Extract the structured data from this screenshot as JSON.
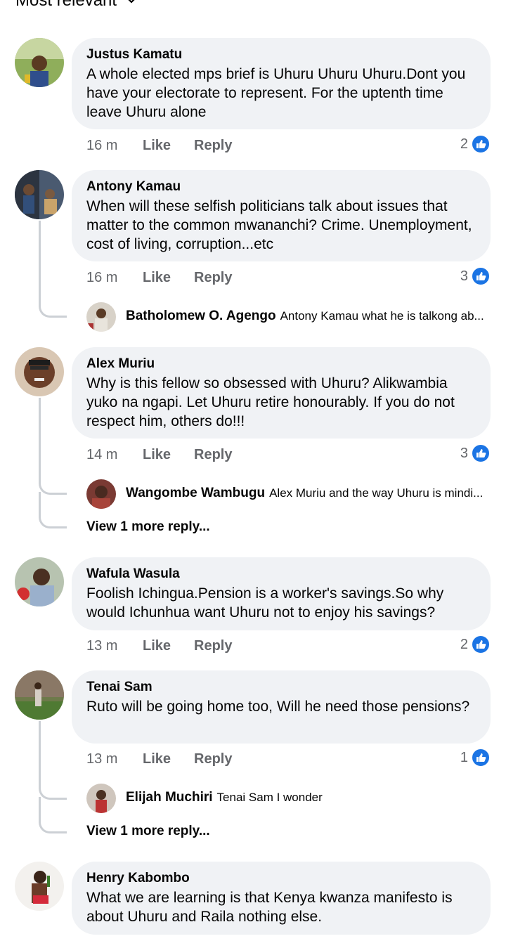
{
  "sort": {
    "label": "Most relevant"
  },
  "comments": [
    {
      "author": "Justus Kamatu",
      "text": "A whole elected mps brief is Uhuru  Uhuru  Uhuru.Dont you have your electorate to represent. For the uptenth time leave Uhuru alone",
      "time": "16 m",
      "like": "Like",
      "reply": "Reply",
      "reactions": "2"
    },
    {
      "author": "Antony Kamau",
      "text": "When will these selfish politicians talk about issues that matter to the common mwananchi? Crime. Unemployment, cost of living, corruption...etc",
      "time": "16 m",
      "like": "Like",
      "reply": "Reply",
      "reactions": "3",
      "reply_preview": {
        "author": "Batholomew O. Agengo",
        "text": "Antony Kamau what he is talkong ab..."
      }
    },
    {
      "author": "Alex Muriu",
      "text": "Why is this fellow so obsessed with Uhuru? Alikwambia yuko na ngapi. Let Uhuru retire honourably. If you do not respect him, others do!!!",
      "time": "14 m",
      "like": "Like",
      "reply": "Reply",
      "reactions": "3",
      "reply_preview": {
        "author": "Wangombe Wambugu",
        "text": "Alex Muriu and the way Uhuru is mindi..."
      },
      "view_more": "View 1 more reply..."
    },
    {
      "author": "Wafula Wasula",
      "text": "Foolish Ichingua.Pension is a worker's  savings.So why would  Ichunhua want Uhuru not to enjoy his savings?",
      "time": "13 m",
      "like": "Like",
      "reply": "Reply",
      "reactions": "2"
    },
    {
      "author": "Tenai Sam",
      "text": "Ruto will be going home too, Will he need those pensions?",
      "time": "13 m",
      "like": "Like",
      "reply": "Reply",
      "reactions": "1",
      "reply_preview": {
        "author": "Elijah Muchiri",
        "text": "Tenai Sam I wonder"
      },
      "view_more": "View 1 more reply..."
    },
    {
      "author": "Henry Kabombo",
      "text": "What we are learning is that Kenya kwanza manifesto is about Uhuru and Raila nothing else."
    }
  ],
  "colors": {
    "bubble": "#f0f2f5",
    "meta": "#65676b",
    "like_blue": "#1b74e4",
    "thread": "#ccd0d5"
  }
}
